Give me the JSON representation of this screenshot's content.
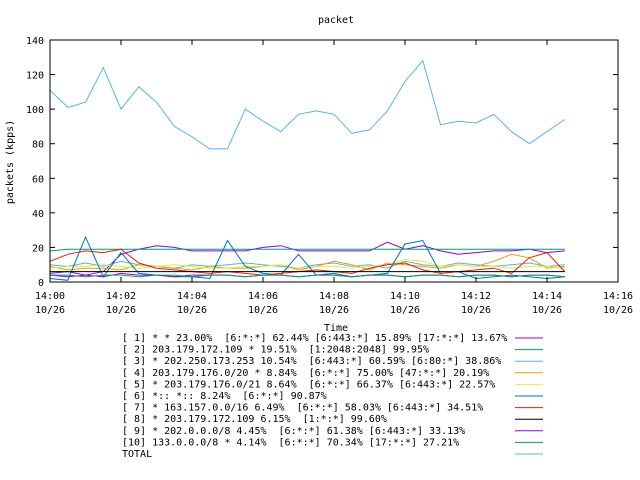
{
  "chart_data": {
    "type": "line",
    "title": "packet",
    "xlabel": "Time",
    "ylabel": "packets (kpps)",
    "ylim": [
      0,
      140
    ],
    "y_ticks": [
      0,
      20,
      40,
      60,
      80,
      100,
      120,
      140
    ],
    "x_ticks": [
      {
        "time": "14:00",
        "date": "10/26"
      },
      {
        "time": "14:02",
        "date": "10/26"
      },
      {
        "time": "14:04",
        "date": "10/26"
      },
      {
        "time": "14:06",
        "date": "10/26"
      },
      {
        "time": "14:08",
        "date": "10/26"
      },
      {
        "time": "14:10",
        "date": "10/26"
      },
      {
        "time": "14:12",
        "date": "10/26"
      },
      {
        "time": "14:14",
        "date": "10/26"
      },
      {
        "time": "14:16",
        "date": "10/26"
      }
    ],
    "x_minutes": [
      0,
      0.5,
      1,
      1.5,
      2,
      2.5,
      3,
      3.5,
      4,
      4.5,
      5,
      5.5,
      6,
      6.5,
      7,
      7.5,
      8,
      8.5,
      9,
      9.5,
      10,
      10.5,
      11,
      11.5,
      12,
      12.5,
      13,
      13.5,
      14,
      14.5
    ],
    "legend_placement": "bottom",
    "series": [
      {
        "name": "[ 1] * * 23.00%  [6:*:*] 62.44% [6:443:*] 15.89% [17:*:*] 13.67%",
        "color": "#9400d3",
        "values": [
          5,
          6,
          4,
          6,
          16,
          19,
          21,
          20,
          18,
          18,
          18,
          18,
          20,
          21,
          18,
          18,
          18,
          18,
          18,
          23,
          19,
          21,
          18,
          16,
          17,
          18,
          18,
          19,
          17,
          18
        ]
      },
      {
        "name": "[ 2] 203.179.172.109 * 19.51%  [1:2048:2048] 99.95%",
        "color": "#009e73",
        "values": [
          18,
          19,
          19,
          19,
          19,
          19,
          19,
          19,
          19,
          19,
          19,
          19,
          19,
          19,
          19,
          19,
          19,
          19,
          19,
          19,
          19,
          19,
          19,
          19,
          19,
          19,
          19,
          19,
          19,
          19
        ]
      },
      {
        "name": "[ 3] * 202.250.173.253 10.54%  [6:443:*] 60.59% [6:80:*] 38.86%",
        "color": "#56b4e9",
        "values": [
          10,
          9,
          11,
          9,
          12,
          10,
          9,
          8,
          10,
          9,
          10,
          11,
          10,
          9,
          8,
          10,
          11,
          9,
          10,
          8,
          12,
          10,
          9,
          11,
          10,
          9,
          10,
          11,
          9,
          10
        ]
      },
      {
        "name": "[ 4] 203.179.176.0/20 * 8.84%  [6:*:*] 75.00% [47:*:*] 20.19%",
        "color": "#e69f00",
        "values": [
          9,
          7,
          8,
          8,
          7,
          10,
          9,
          8,
          7,
          9,
          8,
          8,
          9,
          10,
          7,
          9,
          12,
          10,
          7,
          11,
          10,
          9,
          8,
          10,
          9,
          12,
          16,
          14,
          8,
          9
        ]
      },
      {
        "name": "[ 5] * 203.179.176.0/21 8.64%  [6:*:*] 66.37% [6:443:*] 22.57%",
        "color": "#f0e442",
        "values": [
          8,
          9,
          9,
          10,
          9,
          8,
          9,
          10,
          9,
          8,
          8,
          9,
          9,
          10,
          8,
          9,
          9,
          8,
          9,
          10,
          13,
          12,
          9,
          10,
          9,
          9,
          8,
          9,
          9,
          8
        ]
      },
      {
        "name": "[ 6] *:: *:: 8.24%  [6:*:*] 90.87%",
        "color": "#0072b2",
        "values": [
          2,
          1,
          26,
          3,
          17,
          5,
          4,
          3,
          3,
          2,
          24,
          9,
          5,
          4,
          16,
          4,
          5,
          3,
          4,
          5,
          22,
          24,
          5,
          6,
          2,
          3,
          4,
          3,
          2,
          3
        ]
      },
      {
        "name": "[ 7] * 163.157.0.0/16 6.49%  [6:*:*] 58.03% [6:443:*] 34.51%",
        "color": "#e51e10",
        "values": [
          12,
          16,
          18,
          17,
          19,
          11,
          8,
          7,
          6,
          5,
          6,
          5,
          4,
          5,
          6,
          7,
          6,
          5,
          8,
          10,
          11,
          7,
          5,
          6,
          7,
          8,
          5,
          14,
          17,
          6
        ]
      },
      {
        "name": "[ 8] * 203.179.172.109 6.15%  [1:*:*] 99.60%",
        "color": "#000000",
        "values": [
          6,
          6,
          6,
          6,
          6,
          6,
          6,
          6,
          6,
          6,
          6,
          6,
          6,
          6,
          6,
          6,
          6,
          6,
          6,
          6,
          6,
          6,
          6,
          6,
          6,
          6,
          6,
          6,
          6,
          6
        ]
      },
      {
        "name": "[ 9] * 202.0.0.0/8 4.45%  [6:*:*] 61.38% [6:443:*] 33.13%",
        "color": "#9400d3",
        "values": [
          4,
          3,
          4,
          3,
          5,
          4,
          4,
          3,
          4,
          4,
          4,
          3,
          4,
          4,
          3,
          4,
          4,
          3,
          4,
          4,
          3,
          4,
          4,
          3,
          4,
          4,
          3,
          4,
          4,
          3
        ]
      },
      {
        "name": "[10] 133.0.0.0/8 * 4.14%  [6:*:*] 70.34% [17:*:*] 27.21%",
        "color": "#009e73",
        "values": [
          4,
          4,
          3,
          4,
          4,
          3,
          4,
          4,
          3,
          4,
          4,
          3,
          4,
          4,
          3,
          4,
          4,
          3,
          4,
          4,
          3,
          4,
          4,
          3,
          4,
          4,
          3,
          4,
          4,
          3
        ]
      },
      {
        "name": "TOTAL",
        "color": "#56b4e9",
        "values": [
          111,
          101,
          104,
          124,
          100,
          113,
          104,
          90,
          84,
          77,
          77,
          100,
          93,
          87,
          97,
          99,
          97,
          86,
          88,
          99,
          116,
          128,
          91,
          93,
          92,
          97,
          87,
          80,
          87,
          94
        ]
      }
    ]
  }
}
